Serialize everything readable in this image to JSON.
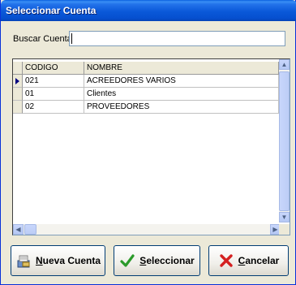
{
  "window": {
    "title": "Seleccionar Cuenta"
  },
  "search": {
    "label": "Buscar Cuenta:",
    "value": "",
    "placeholder": ""
  },
  "grid": {
    "headers": [
      "CODIGO",
      "NOMBRE"
    ],
    "rows": [
      {
        "codigo": "021",
        "nombre": "ACREEDORES VARIOS",
        "current": true
      },
      {
        "codigo": "01",
        "nombre": "Clientes",
        "current": false
      },
      {
        "codigo": "02",
        "nombre": "PROVEEDORES",
        "current": false
      }
    ]
  },
  "buttons": {
    "new_account": {
      "accel": "N",
      "rest": "ueva Cuenta",
      "icon": "new-account-icon"
    },
    "select": {
      "accel": "S",
      "rest": "eleccionar",
      "icon": "checkmark-icon"
    },
    "cancel": {
      "accel": "C",
      "rest": "ancelar",
      "icon": "red-x-icon"
    }
  },
  "colors": {
    "titlebar": "#0a58d8",
    "window_bg": "#ece9d8",
    "selected_indicator": "#000080"
  }
}
